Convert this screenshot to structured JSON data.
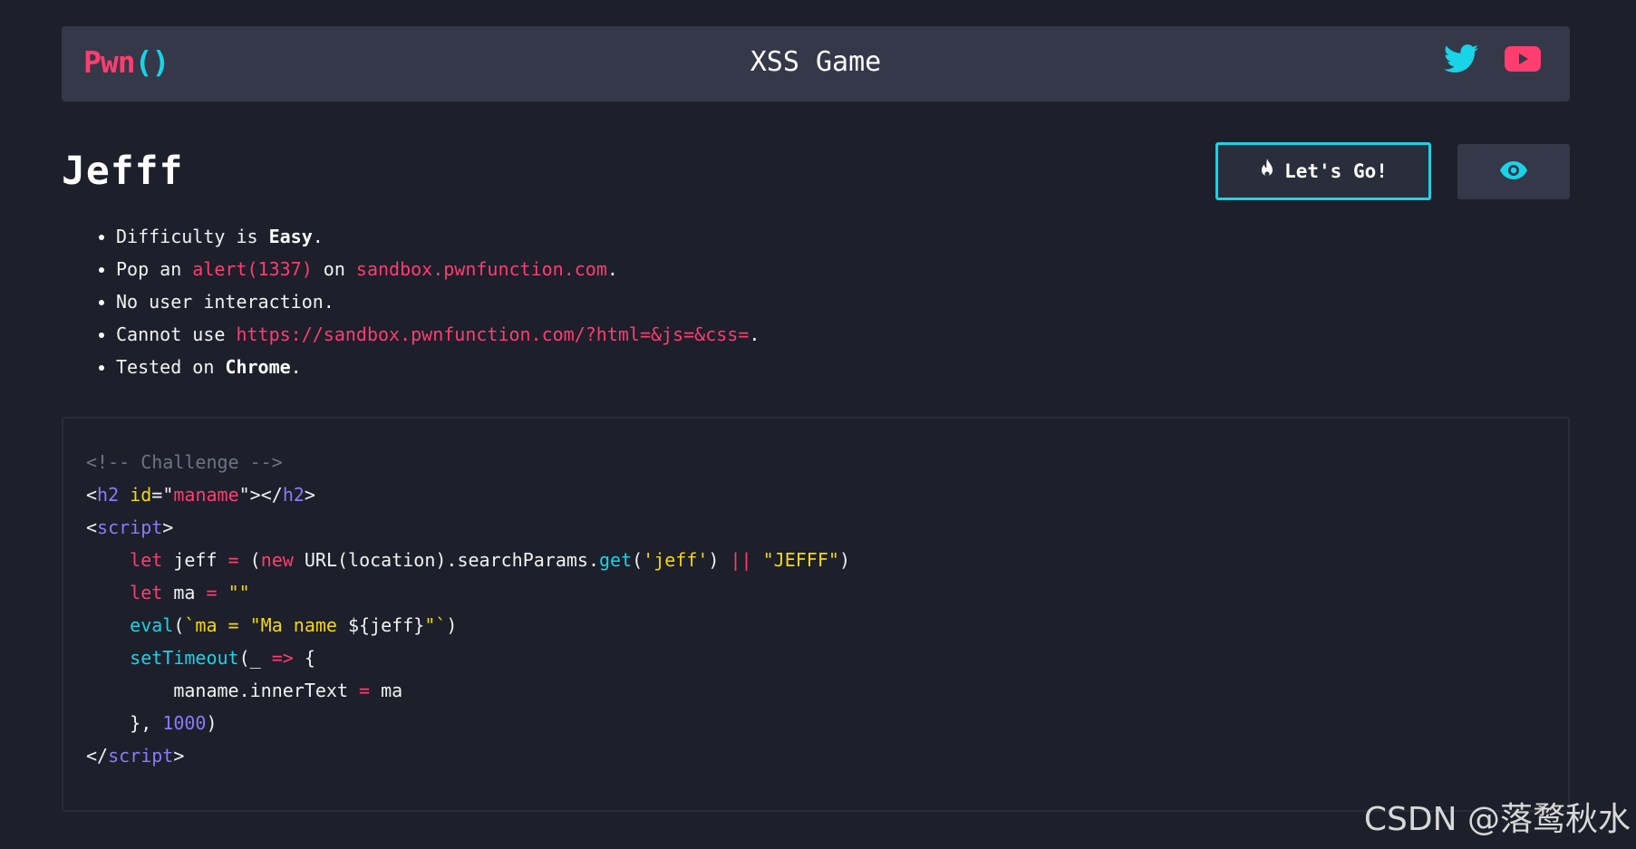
{
  "header": {
    "brand_name": "Pwn",
    "brand_parens": "()",
    "title": "XSS Game",
    "social_icons": [
      "twitter-icon",
      "youtube-icon"
    ]
  },
  "level": {
    "title": "Jefff"
  },
  "buttons": {
    "go_label": "Let's Go!",
    "go_icon": "flame-icon",
    "view_icon": "eye-icon"
  },
  "rules": {
    "r1_prefix": "Difficulty is ",
    "r1_strong": "Easy",
    "r1_suffix": ".",
    "r2_prefix": "Pop an ",
    "r2_code": "alert(1337)",
    "r2_mid": " on ",
    "r2_domain": "sandbox.pwnfunction.com",
    "r2_suffix": ".",
    "r3": "No user interaction.",
    "r4_prefix": "Cannot use ",
    "r4_code": "https://sandbox.pwnfunction.com/?html=&js=&css=",
    "r4_suffix": ".",
    "r5_prefix": "Tested on ",
    "r5_strong": "Chrome",
    "r5_suffix": "."
  },
  "code_tokens": {
    "l1": "<!-- Challenge -->",
    "lt": "<",
    "gt": ">",
    "close_open": "</",
    "h2": "h2",
    "id_attr": "id",
    "eq": "=",
    "q": "\"",
    "maname": "maname",
    "script": "script",
    "let": "let",
    "jeff_var": "jeff",
    "new": "new",
    "url_chain": "URL(location).searchParams.",
    "get": "get",
    "jeff_str": "'jeff'",
    "or": "||",
    "jefff_str": "\"JEFFF\"",
    "ma_var": "ma",
    "empty_str": "\"\"",
    "eval": "eval",
    "tpl_open": "`ma = ",
    "tpl_str": "\"Ma name ",
    "tpl_interp": "${jeff}",
    "tpl_close": "\"`",
    "setTimeout": "setTimeout",
    "arrow": "=>",
    "inner": "maname.innerText",
    "num": "1000"
  },
  "watermark": "CSDN @落鹜秋水",
  "colors": {
    "accent_pink": "#ff3d6f",
    "accent_cyan": "#19d3e6",
    "panel": "#353849",
    "background": "#1d1f2b"
  }
}
